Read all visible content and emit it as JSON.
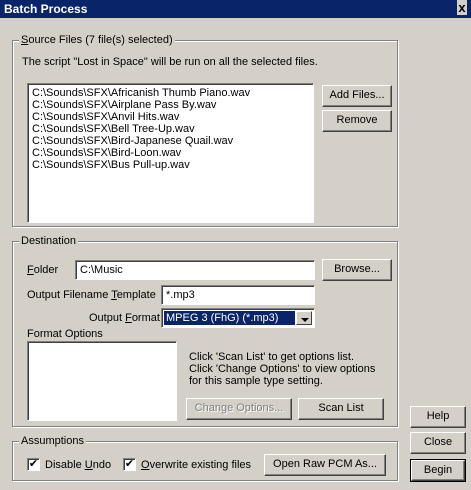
{
  "window": {
    "title": "Batch Process",
    "close_glyph": "x"
  },
  "source": {
    "legend_prefix": "S",
    "legend_rest": "ource Files (7 file(s) selected)",
    "description": "The script \"Lost in Space\" will be run on all the selected files.",
    "files": [
      "C:\\Sounds\\SFX\\Africanish Thumb Piano.wav",
      "C:\\Sounds\\SFX\\Airplane Pass By.wav",
      "C:\\Sounds\\SFX\\Anvil Hits.wav",
      "C:\\Sounds\\SFX\\Bell Tree-Up.wav",
      "C:\\Sounds\\SFX\\Bird-Japanese Quail.wav",
      "C:\\Sounds\\SFX\\Bird-Loon.wav",
      "C:\\Sounds\\SFX\\Bus Pull-up.wav"
    ],
    "add_files_label": "Add Files...",
    "remove_label": "Remove"
  },
  "destination": {
    "legend": "Destination",
    "folder_label_u": "F",
    "folder_label_rest": "older",
    "folder_value": "C:\\Music",
    "browse_label": "Browse...",
    "template_label_pre": "Output Filename ",
    "template_label_u": "T",
    "template_label_rest": "emplate",
    "template_value": "*.mp3",
    "format_label_pre": "Output ",
    "format_label_u": "F",
    "format_label_rest": "ormat",
    "format_value": "MPEG 3 (FhG) (*.mp3)",
    "format_options_label": "Format Options",
    "options_help_1": "Click 'Scan List' to get options list.",
    "options_help_2": "Click 'Change Options' to view options",
    "options_help_3": "for this sample type setting.",
    "change_options_label": "Change Options...",
    "scan_list_label": "Scan List"
  },
  "assumptions": {
    "legend": "Assumptions",
    "disable_undo_pre": "Disable ",
    "disable_undo_u": "U",
    "disable_undo_rest": "ndo",
    "disable_undo_checked": true,
    "overwrite_u": "O",
    "overwrite_rest": "verwrite existing files",
    "overwrite_checked": true,
    "open_raw_label": "Open Raw PCM As..."
  },
  "side_buttons": {
    "help": "Help",
    "close": "Close",
    "begin": "Begin"
  },
  "check_glyph": "✔"
}
